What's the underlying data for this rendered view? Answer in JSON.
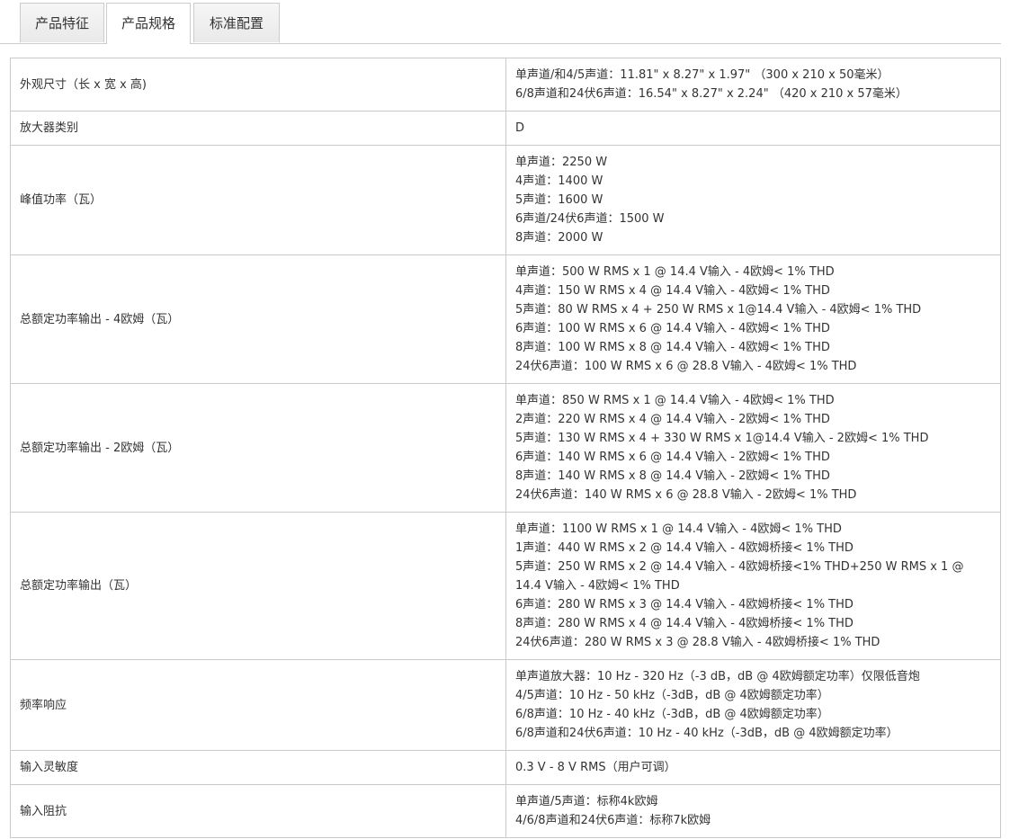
{
  "tabs": [
    {
      "label": "产品特征",
      "active": false
    },
    {
      "label": "产品规格",
      "active": true
    },
    {
      "label": "标准配置",
      "active": false
    }
  ],
  "specs": [
    {
      "label": "外观尺寸（长 x 宽 x 高)",
      "values": [
        "单声道/和4/5声道：11.81\" x 8.27\" x 1.97\" （300 x 210 x 50毫米）",
        "6/8声道和24伏6声道：16.54\" x 8.27\" x 2.24\" （420 x 210 x 57毫米）"
      ]
    },
    {
      "label": "放大器类别",
      "values": [
        "D"
      ]
    },
    {
      "label": "峰值功率（瓦）",
      "values": [
        "单声道：2250 W",
        "4声道：1400 W",
        "5声道：1600 W",
        "6声道/24伏6声道：1500 W",
        "8声道：2000 W"
      ]
    },
    {
      "label": "总额定功率输出 - 4欧姆（瓦）",
      "values": [
        "单声道：500 W RMS x 1 @ 14.4 V输入 - 4欧姆< 1% THD",
        "4声道：150 W RMS x 4 @ 14.4 V输入 - 4欧姆< 1% THD",
        "5声道：80 W RMS x 4 + 250 W RMS x 1@14.4 V输入 - 4欧姆< 1% THD",
        "6声道：100 W RMS x 6 @ 14.4 V输入 - 4欧姆< 1% THD",
        "8声道：100 W RMS x 8 @ 14.4 V输入 - 4欧姆< 1% THD",
        "24伏6声道：100 W RMS x 6 @ 28.8 V输入 - 4欧姆< 1% THD"
      ]
    },
    {
      "label": "总额定功率输出 - 2欧姆（瓦）",
      "values": [
        "单声道：850 W RMS x 1 @ 14.4 V输入 - 4欧姆< 1% THD",
        "2声道：220 W RMS x 4 @ 14.4 V输入 - 2欧姆< 1% THD",
        "5声道：130 W RMS x 4 + 330 W RMS x 1@14.4 V输入 - 2欧姆< 1% THD",
        "6声道：140 W RMS x 6 @ 14.4 V输入 - 2欧姆< 1% THD",
        "8声道：140 W RMS x 8 @ 14.4 V输入 - 2欧姆< 1% THD",
        "24伏6声道：140 W RMS x 6 @ 28.8 V输入 - 2欧姆< 1% THD"
      ]
    },
    {
      "label": "总额定功率输出（瓦）",
      "values": [
        "单声道：1100 W RMS x 1 @ 14.4 V输入 - 4欧姆< 1% THD",
        "1声道：440 W RMS x 2 @ 14.4 V输入 - 4欧姆桥接< 1% THD",
        "5声道：250 W RMS x 2 @ 14.4 V输入 - 4欧姆桥接<1% THD+250 W RMS x 1 @ 14.4 V输入 - 4欧姆< 1% THD",
        "6声道：280 W RMS x 3 @ 14.4 V输入 - 4欧姆桥接< 1% THD",
        "8声道：280 W RMS x 4 @ 14.4 V输入 - 4欧姆桥接< 1% THD",
        "24伏6声道：280 W RMS x 3 @ 28.8 V输入 - 4欧姆桥接< 1% THD"
      ]
    },
    {
      "label": "频率响应",
      "values": [
        "单声道放大器：10 Hz - 320 Hz（-3 dB，dB @ 4欧姆额定功率）仅限低音炮",
        "4/5声道：10 Hz - 50 kHz（-3dB，dB @ 4欧姆额定功率）",
        "6/8声道：10 Hz - 40 kHz（-3dB，dB @ 4欧姆额定功率）",
        "6/8声道和24伏6声道：10 Hz - 40 kHz（-3dB，dB @ 4欧姆额定功率）"
      ]
    },
    {
      "label": "输入灵敏度",
      "values": [
        "0.3 V - 8 V RMS（用户可调）"
      ]
    },
    {
      "label": "输入阻抗",
      "values": [
        "单声道/5声道：标称4k欧姆",
        "4/6/8声道和24伏6声道：标称7k欧姆"
      ]
    }
  ]
}
